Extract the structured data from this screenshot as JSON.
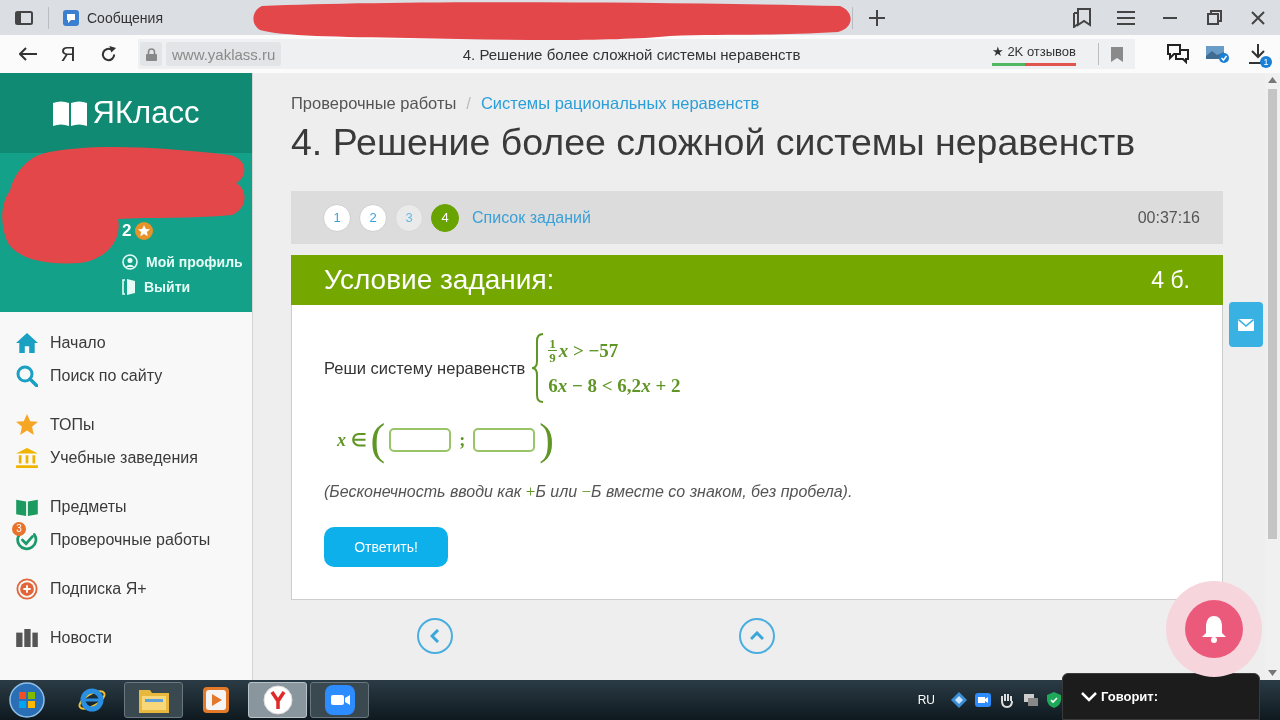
{
  "browser": {
    "tabs": [
      {
        "label": "Сообщения",
        "selected": false
      }
    ],
    "home_label": "Я",
    "url": "www.yaklass.ru",
    "page_title": "4. Решение более сложной системы неравенств",
    "reviews": {
      "label": "★ 2K отзывов",
      "level": 0.4
    },
    "downloads_badge": "1"
  },
  "sidebar": {
    "logo": "ЯКласс",
    "user": {
      "points": "2",
      "links": [
        "Мой профиль",
        "Выйти"
      ]
    },
    "groups": [
      {
        "items": [
          {
            "label": "Начало"
          },
          {
            "label": "Поиск по сайту"
          }
        ]
      },
      {
        "items": [
          {
            "label": "ТОПы"
          },
          {
            "label": "Учебные заведения"
          }
        ]
      },
      {
        "items": [
          {
            "label": "Предметы"
          },
          {
            "label": "Проверочные работы",
            "badge": "3"
          }
        ]
      },
      {
        "items": [
          {
            "label": "Подписка Я+"
          }
        ]
      },
      {
        "items": [
          {
            "label": "Новости"
          }
        ]
      }
    ]
  },
  "breadcrumbs": {
    "separator": "/",
    "items": [
      {
        "label": "Проверочные работы",
        "kind": "text"
      },
      {
        "label": "Системы рациональных неравенств",
        "kind": "link"
      }
    ]
  },
  "title": "4. Решение более сложной системы неравенств",
  "pager": {
    "tasks": [
      {
        "label": "1",
        "selected": false,
        "dimmed": false
      },
      {
        "label": "2",
        "selected": false,
        "dimmed": false
      },
      {
        "label": "3",
        "selected": false,
        "dimmed": true
      },
      {
        "label": "4",
        "selected": true,
        "dimmed": false
      }
    ],
    "list_link": "Список заданий",
    "timer": "00:37:16"
  },
  "task": {
    "header": "Условие задания:",
    "points": "4 б.",
    "prompt": "Реши систему неравенств",
    "system": [
      {
        "kind": "fraction",
        "numerator": "1",
        "denominator": "9",
        "parts": [
          {
            "kind": "var",
            "text": "x"
          },
          {
            "kind": "text",
            "text": " > −57"
          }
        ]
      },
      {
        "kind": "plain",
        "parts": [
          {
            "kind": "text",
            "text": "6"
          },
          {
            "kind": "var",
            "text": "x"
          },
          {
            "kind": "text",
            "text": " − 8 < 6,2"
          },
          {
            "kind": "var",
            "text": "x"
          },
          {
            "kind": "text",
            "text": " + 2"
          }
        ]
      }
    ],
    "answer": {
      "label": [
        {
          "kind": "var",
          "text": "x"
        },
        {
          "kind": "text",
          "text": " ∈"
        }
      ],
      "open": "(",
      "separator": ";",
      "close": ")",
      "fields": [
        {
          "kind": "input"
        },
        {
          "kind": "input"
        }
      ]
    },
    "hint": [
      {
        "kind": "text",
        "text": "(Бесконечность вводи как "
      },
      {
        "kind": "math",
        "text": "+"
      },
      {
        "kind": "text",
        "text": "Б или "
      },
      {
        "kind": "math",
        "text": "−"
      },
      {
        "kind": "text",
        "text": "Б вместе со знаком, без пробела)."
      }
    ],
    "submit": "Ответить!"
  },
  "taskbar": {
    "apps": [
      {
        "running": false,
        "selected": false
      },
      {
        "running": true,
        "selected": false
      },
      {
        "running": false,
        "selected": false
      },
      {
        "running": true,
        "selected": true
      },
      {
        "running": true,
        "selected": false
      }
    ],
    "language": "RU",
    "speaking": "Говорит:"
  }
}
